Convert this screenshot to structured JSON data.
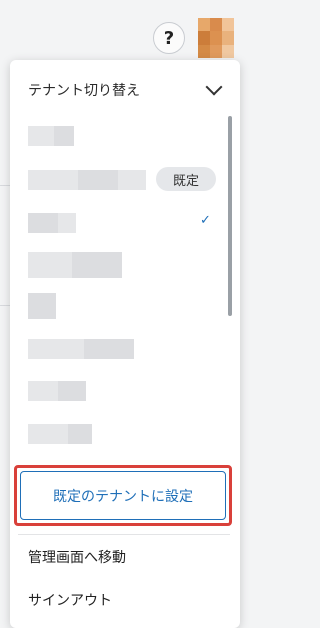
{
  "header": {
    "help_label": "?",
    "avatar_colors": [
      "#e7a86a",
      "#d98b4c",
      "#f1c499",
      "#cc7d3a",
      "#dc9150",
      "#e9b27d",
      "#d48a45",
      "#e09a5d",
      "#f0c8a0"
    ]
  },
  "tenant_switcher": {
    "title": "テナント切り替え",
    "default_badge": "既定",
    "selected_check": "✓",
    "set_default_button": "既定のテナントに設定"
  },
  "menu": {
    "admin_label": "管理画面へ移動",
    "signout_label": "サインアウト"
  },
  "colors": {
    "accent": "#1f6fb8",
    "highlight_border": "#d9403a"
  }
}
